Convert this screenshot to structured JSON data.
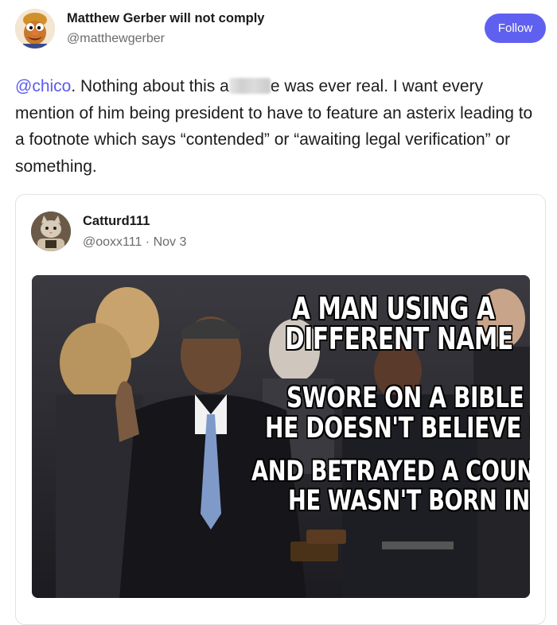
{
  "post": {
    "author": {
      "name": "Matthew Gerber will not comply",
      "handle": "@matthewgerber"
    },
    "follow_label": "Follow",
    "text": {
      "mention": "@chico",
      "part1": ". Nothing about this a",
      "part2": "e was ever real. I want every mention of him being president to have to feature an asterix leading to a footnote which says “contended” or “awaiting legal verification” or something."
    }
  },
  "quote": {
    "author": {
      "name": "Catturd111",
      "handle_date": "@ooxx111 · Nov 3"
    },
    "image": {
      "caption_lines": [
        "A MAN USING A",
        "DIFFERENT NAME",
        "SWORE ON A BIBLE",
        "HE DOESN'T BELIEVE IN",
        "AND BETRAYED A COUNTRY",
        "HE WASN'T BORN IN"
      ]
    }
  },
  "colors": {
    "accent": "#6060f0",
    "mention": "#5b5bf0",
    "handle": "#6b6b6b"
  }
}
